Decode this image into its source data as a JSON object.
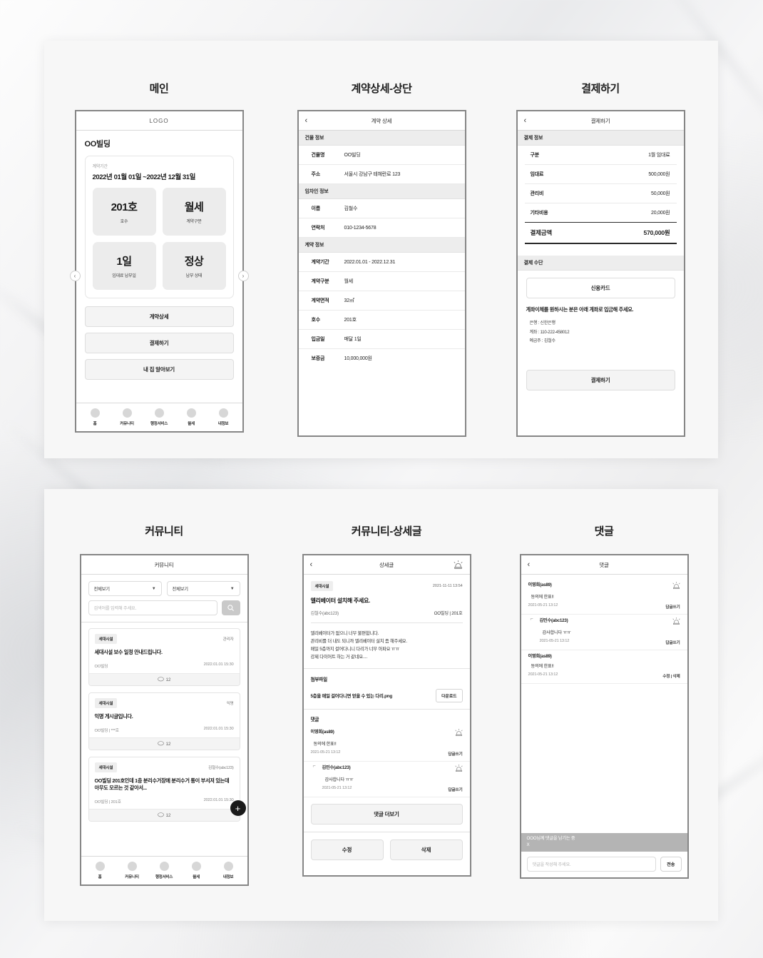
{
  "screens": {
    "main": {
      "caption": "메인",
      "logo": "LOGO",
      "building": "OO빌딩",
      "period_label": "계약기간",
      "period_value": "2022년 01월 01일 ~2022년 12월 31일",
      "tiles": [
        {
          "value": "201호",
          "label": "호수"
        },
        {
          "value": "월세",
          "label": "계약구분"
        },
        {
          "value": "1일",
          "label": "임대료 납부일"
        },
        {
          "value": "정상",
          "label": "납부 상태"
        }
      ],
      "prev_icon": "chevron-left-icon",
      "next_icon": "chevron-right-icon",
      "actions": [
        "계약상세",
        "결제하기",
        "내 집 알아보기"
      ]
    },
    "contract": {
      "caption": "계약상세-상단",
      "title": "계약 상세",
      "sections": [
        {
          "heading": "건물 정보",
          "rows": [
            {
              "key": "건물명",
              "value": "OO빌딩"
            },
            {
              "key": "주소",
              "value": "서울시 강남구 테헤란로 123"
            }
          ]
        },
        {
          "heading": "임차인 정보",
          "rows": [
            {
              "key": "이름",
              "value": "김철수"
            },
            {
              "key": "연락처",
              "value": "010-1234-5678"
            }
          ]
        },
        {
          "heading": "계약 정보",
          "rows": [
            {
              "key": "계약기간",
              "value": "2022.01.01 - 2022.12.31"
            },
            {
              "key": "계약구분",
              "value": "월세"
            },
            {
              "key": "계약면적",
              "value": "32㎡"
            },
            {
              "key": "호수",
              "value": "201호"
            },
            {
              "key": "입금일",
              "value": "매달 1일"
            },
            {
              "key": "보증금",
              "value": "10,000,000원"
            }
          ]
        }
      ]
    },
    "payment": {
      "caption": "결제하기",
      "title": "결제하기",
      "info_heading": "결제 정보",
      "rows": [
        {
          "key": "구분",
          "value": "1월 임대료"
        },
        {
          "key": "임대료",
          "value": "500,000원"
        },
        {
          "key": "관리비",
          "value": "50,000원"
        },
        {
          "key": "기타비용",
          "value": "20,000원"
        }
      ],
      "total": {
        "key": "결제금액",
        "value": "570,000원"
      },
      "method_heading": "결제 수단",
      "card_button": "신용카드",
      "transfer_headline": "계좌이체를 원하시는 분은 아래 계좌로 입금해 주세요.",
      "bank_lines": [
        "은행 : 신한은행",
        "계좌 : 110-222-458012",
        "예금주 : 김철수"
      ],
      "pay_button": "결제하기"
    },
    "community": {
      "caption": "커뮤니티",
      "title": "커뮤니티",
      "filters": [
        {
          "value": "전체보기",
          "caret": "▼"
        },
        {
          "value": "전체보기",
          "caret": "▼"
        }
      ],
      "search_placeholder": "검색어를 입력해 주세요.",
      "search_icon": "search-icon",
      "fab_icon": "plus-icon",
      "posts": [
        {
          "tag": "세대시설",
          "author": "관리자",
          "title": "세대시설 보수 일정 안내드립니다.",
          "place": "OO빌딩",
          "date": "2022.01.01  15:30",
          "comments": "12"
        },
        {
          "tag": "세대시설",
          "author": "익명",
          "title": "익명 게시글입니다.",
          "place": "OO빌딩 | ***호",
          "date": "2022.01.01  15:30",
          "comments": "12"
        },
        {
          "tag": "세대시설",
          "author": "김철수(abc123)",
          "title": "OO빌딩 201호인데 1층 분리수거장에 분리수거 통이 부서져 있는데 아무도 모르는 것 같아서...",
          "place": "OO빌딩 | 201호",
          "date": "2022.01.01  15:30",
          "comments": "12"
        }
      ],
      "tabs": [
        {
          "label": "홈"
        },
        {
          "label": "커뮤니티"
        },
        {
          "label": "행정서비스"
        },
        {
          "label": "월세"
        },
        {
          "label": "내정보"
        }
      ]
    },
    "detail": {
      "caption": "커뮤니티-상세글",
      "title": "상세글",
      "siren_icon": "siren-icon",
      "tag": "세대시설",
      "date": "2021-11-11 13:54",
      "post_title": "엘리베이터 설치해 주세요.",
      "author": "김철수(abc123)",
      "place": "OO빌딩 | 201호",
      "body_lines": [
        "엘리베이터가 없으니 너무 불편합니다.",
        "관리비를 더 내도 되니까 엘리베이터 설치 좀 해주세요.",
        "매일 5층까지 걸어다니니 다리가 너무 아파요 ㅠㅠ",
        "강제 다이어트 하는 거 같네요...."
      ],
      "file_heading": "첨부파일",
      "file_name": "5층을 매일 걸어다니면 얻을 수 있는 다리.png",
      "download_button": "다운로드",
      "comments_heading": "댓글",
      "comments": [
        {
          "user": "이영희(as89)",
          "text": "동의에 한표!!",
          "date": "2021-05-21 13:12",
          "action": "답글쓰기",
          "reply": false
        },
        {
          "user": "김민수(abc123)",
          "text": "감사합니다 ㅠㅠ",
          "date": "2021-05-21 13:12",
          "action": "답글쓰기",
          "reply": true
        }
      ],
      "more_button": "댓글 더보기",
      "edit_button": "수정",
      "delete_button": "삭제"
    },
    "comments": {
      "caption": "댓글",
      "title": "댓글",
      "items": [
        {
          "user": "이영희(as89)",
          "text": "동의에 한표!!",
          "date": "2021-05-21 13:12",
          "action": "답글쓰기",
          "reply": false,
          "siren": true
        },
        {
          "user": "김민수(abc123)",
          "text": "감사합니다 ㅠㅠ",
          "date": "2021-05-21 13:12",
          "action": "답글쓰기",
          "reply": true,
          "siren": true
        },
        {
          "user": "이영희(as89)",
          "text": "동의에 한표!!",
          "date": "2021-05-21 13:12",
          "action": "수정 | 삭제",
          "reply": false,
          "siren": false
        }
      ],
      "reply_banner": "OOO님께 댓글을 남기는 중",
      "reply_close": "X",
      "input_placeholder": "댓글을 작성해 주세요.",
      "send_button": "전송"
    }
  }
}
